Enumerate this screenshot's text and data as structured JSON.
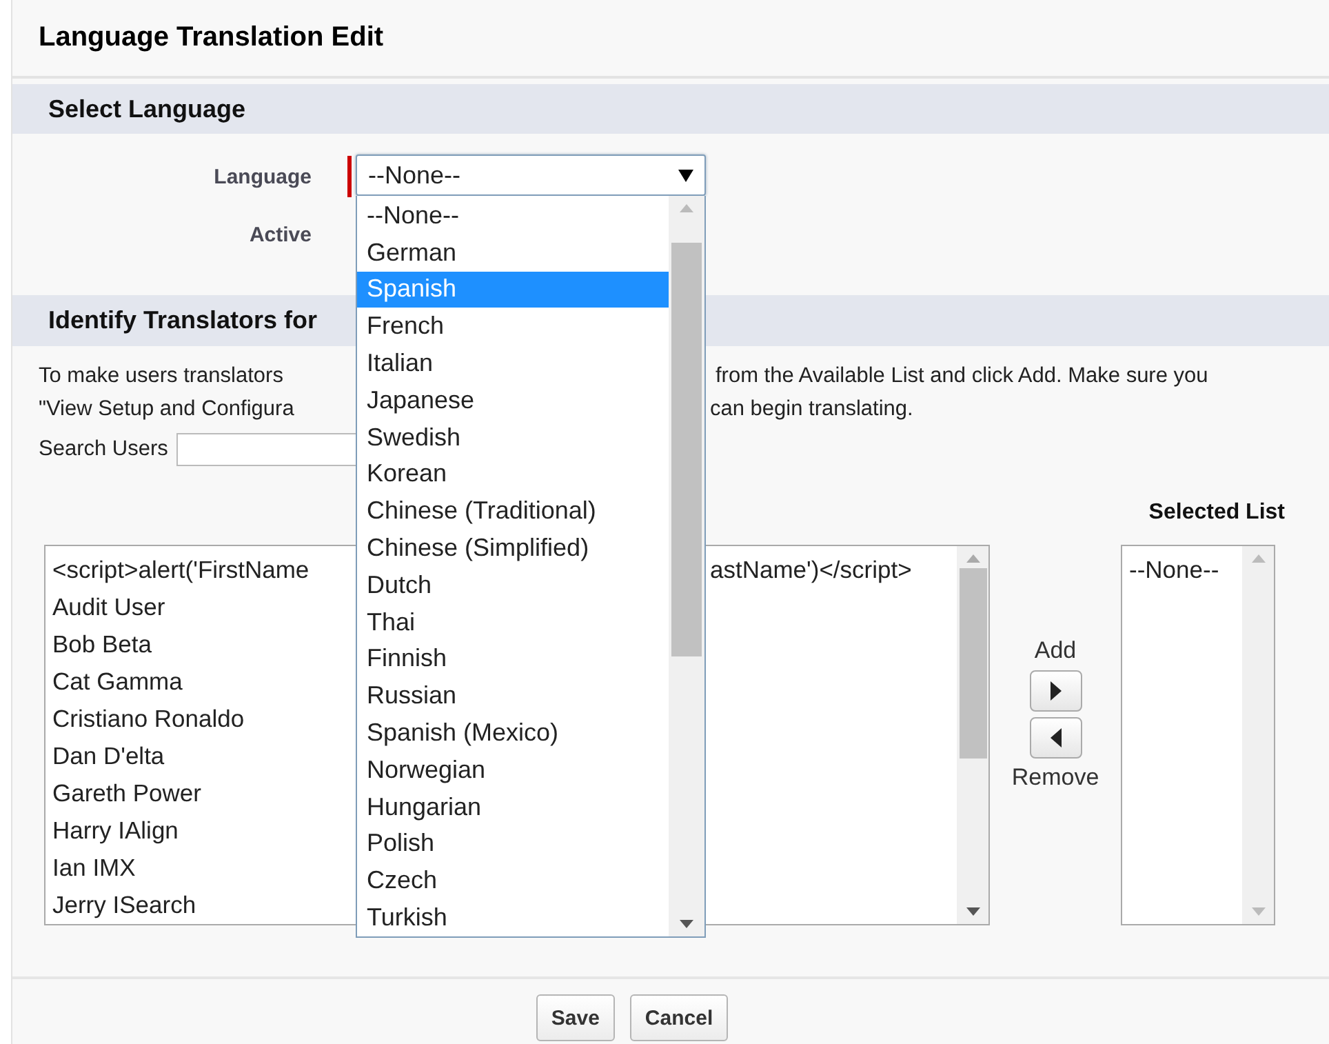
{
  "page_title": "Language Translation Edit",
  "select_language": {
    "heading": "Select Language",
    "fields": [
      {
        "label": "Language",
        "required": true,
        "value": "--None--"
      },
      {
        "label": "Active",
        "required": false
      }
    ]
  },
  "language_dropdown": {
    "expanded": true,
    "options": [
      {
        "label": "--None--",
        "selected": false
      },
      {
        "label": "German",
        "selected": false
      },
      {
        "label": "Spanish",
        "selected": true
      },
      {
        "label": "French",
        "selected": false
      },
      {
        "label": "Italian",
        "selected": false
      },
      {
        "label": "Japanese",
        "selected": false
      },
      {
        "label": "Swedish",
        "selected": false
      },
      {
        "label": "Korean",
        "selected": false
      },
      {
        "label": "Chinese (Traditional)",
        "selected": false
      },
      {
        "label": "Chinese (Simplified)",
        "selected": false
      },
      {
        "label": "Dutch",
        "selected": false
      },
      {
        "label": "Thai",
        "selected": false
      },
      {
        "label": "Finnish",
        "selected": false
      },
      {
        "label": "Russian",
        "selected": false
      },
      {
        "label": "Spanish (Mexico)",
        "selected": false
      },
      {
        "label": "Norwegian",
        "selected": false
      },
      {
        "label": "Hungarian",
        "selected": false
      },
      {
        "label": "Polish",
        "selected": false
      },
      {
        "label": "Czech",
        "selected": false
      },
      {
        "label": "Turkish",
        "selected": false
      }
    ]
  },
  "translators": {
    "heading": "Identify Translators for",
    "instructions": [
      {
        "left": "To make users translators",
        "right": "from the Available List and click Add. Make sure you"
      },
      {
        "left": "\"View Setup and Configura",
        "right": "can begin translating."
      }
    ],
    "search_label": "Search Users",
    "available_list": {
      "items": [
        {
          "left": "<script>alert('FirstName",
          "right": "astName')</script>"
        },
        {
          "left": "Audit User"
        },
        {
          "left": "Bob Beta"
        },
        {
          "left": "Cat Gamma"
        },
        {
          "left": "Cristiano Ronaldo"
        },
        {
          "left": "Dan D'elta"
        },
        {
          "left": "Gareth Power"
        },
        {
          "left": "Harry IAlign"
        },
        {
          "left": "Ian IMX"
        },
        {
          "left": "Jerry ISearch"
        }
      ]
    },
    "add_label": "Add",
    "remove_label": "Remove",
    "selected_list": {
      "label": "Selected List",
      "items": [
        "--None--"
      ]
    }
  },
  "buttons": [
    "Save",
    "Cancel"
  ]
}
